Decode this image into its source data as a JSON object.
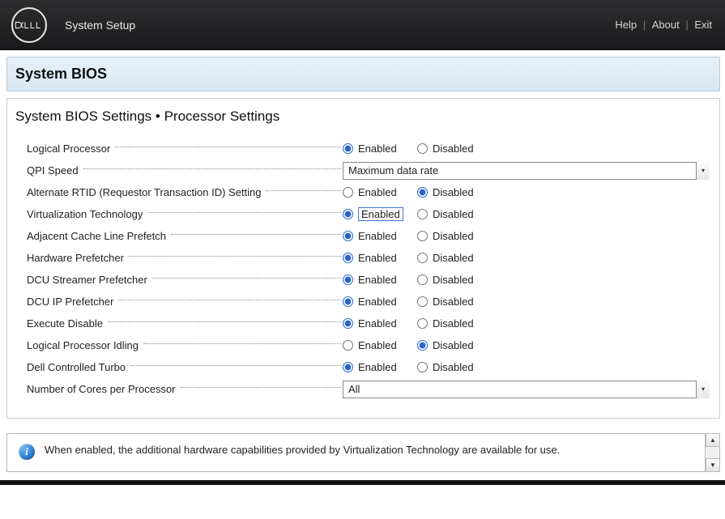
{
  "topbar": {
    "brand": "DELL",
    "title": "System Setup",
    "links": {
      "help": "Help",
      "about": "About",
      "exit": "Exit"
    }
  },
  "title_bar": {
    "heading": "System BIOS"
  },
  "breadcrumb": "System BIOS Settings • Processor Settings",
  "options": {
    "enabled": "Enabled",
    "disabled": "Disabled"
  },
  "settings": [
    {
      "id": "logical-processor",
      "label": "Logical Processor",
      "type": "radio",
      "value": "enabled"
    },
    {
      "id": "qpi-speed",
      "label": "QPI Speed",
      "type": "select",
      "value": "Maximum data rate"
    },
    {
      "id": "alternate-rtid",
      "label": "Alternate RTID (Requestor Transaction ID) Setting",
      "type": "radio",
      "value": "disabled"
    },
    {
      "id": "virtualization-technology",
      "label": "Virtualization Technology",
      "type": "radio",
      "value": "enabled",
      "highlighted": true
    },
    {
      "id": "adjacent-cache-prefetch",
      "label": "Adjacent Cache Line Prefetch",
      "type": "radio",
      "value": "enabled"
    },
    {
      "id": "hardware-prefetcher",
      "label": "Hardware Prefetcher",
      "type": "radio",
      "value": "enabled"
    },
    {
      "id": "dcu-streamer-prefetcher",
      "label": "DCU Streamer Prefetcher",
      "type": "radio",
      "value": "enabled"
    },
    {
      "id": "dcu-ip-prefetcher",
      "label": "DCU IP Prefetcher",
      "type": "radio",
      "value": "enabled"
    },
    {
      "id": "execute-disable",
      "label": "Execute Disable",
      "type": "radio",
      "value": "enabled"
    },
    {
      "id": "logical-processor-idling",
      "label": "Logical Processor Idling",
      "type": "radio",
      "value": "disabled"
    },
    {
      "id": "dell-controlled-turbo",
      "label": "Dell Controlled Turbo",
      "type": "radio",
      "value": "enabled"
    },
    {
      "id": "cores-per-processor",
      "label": "Number of Cores per Processor",
      "type": "select",
      "value": "All"
    }
  ],
  "help_text": "When enabled, the additional hardware capabilities provided by Virtualization Technology are available for use."
}
